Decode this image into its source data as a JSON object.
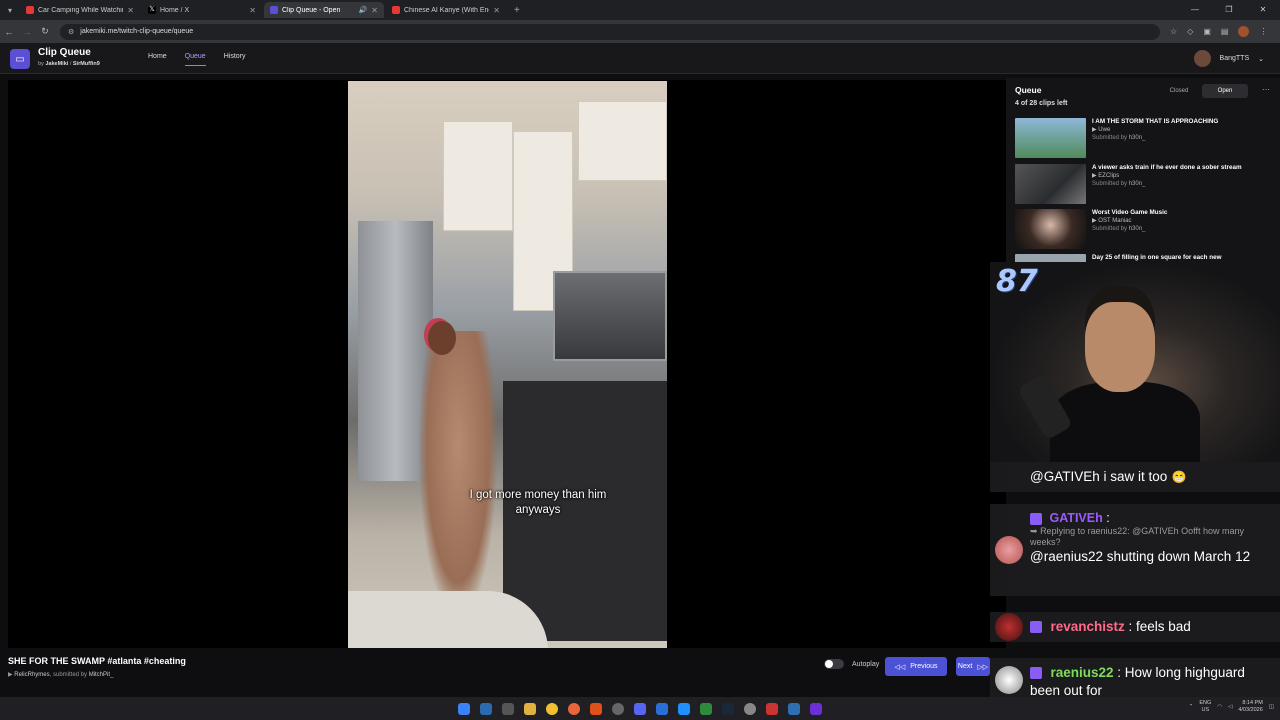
{
  "browser": {
    "tabs": [
      {
        "label": "Car Camping While Watching a",
        "active": false,
        "color": "#e53935"
      },
      {
        "label": "Home / X",
        "active": false,
        "color": "#000000"
      },
      {
        "label": "Clip Queue - Open",
        "active": true,
        "color": "#5b4fd6"
      },
      {
        "label": "Chinese AI Kanye (With English",
        "active": false,
        "color": "#e53935"
      }
    ],
    "url": "jakemiki.me/twitch-clip-queue/queue"
  },
  "app": {
    "title": "Clip Queue",
    "by_prefix": "by",
    "author1": "JakeMiki",
    "separator": "/",
    "author2": "SirMuffin9",
    "nav": [
      "Home",
      "Queue",
      "History"
    ],
    "active_nav": "Queue",
    "username": "BangTTS"
  },
  "video": {
    "caption_line1": "I got more money than him",
    "caption_line2": "anyways"
  },
  "queue": {
    "title": "Queue",
    "remaining": "4 of 28 clips left",
    "toggle_closed": "Closed",
    "toggle_open": "Open",
    "submitted_prefix": "Submitted by",
    "clips": [
      {
        "title": "I AM THE STORM THAT IS APPROACHING",
        "channel": "Uwe",
        "submitter": "h30n_",
        "thumb": "#4f8a5a"
      },
      {
        "title": "A viewer asks train if he ever done a sober stream",
        "channel": "EZClips",
        "submitter": "h30n_",
        "thumb": "#3b3f44"
      },
      {
        "title": "Worst Video Game Music",
        "channel": "OST Maniac",
        "submitter": "h30n_",
        "thumb": "#2d2a28"
      },
      {
        "title": "Day 25 of filling in one square for each new",
        "channel": "",
        "submitter": "",
        "thumb": "#9aa4ad"
      }
    ]
  },
  "stream": {
    "counter": "87"
  },
  "chat": [
    {
      "name": "",
      "body": "@GATIVEh i saw it too",
      "emote": "😁",
      "color": "#ffffff"
    },
    {
      "name": "GATIVEh",
      "reply": "Replying to raenius22: @GATIVEh Oofft how many weeks?",
      "body": "@raenius22 shutting down March 12",
      "color": "#9a5cff"
    },
    {
      "name": "revanchistz",
      "body": "feels bad",
      "color": "#ff6a8a"
    },
    {
      "name": "raenius22",
      "body": "How long highguard been out for",
      "color": "#7fdc5a"
    }
  ],
  "current_clip": {
    "title": "SHE FOR THE SWAMP #atlanta #cheating",
    "channel": "RelicRhymes",
    "submitted_by_label": "submitted by",
    "submitter": "MitchPit_"
  },
  "controls": {
    "autoplay_label": "Autoplay",
    "previous_label": "Previous",
    "next_label": "Next"
  },
  "taskbar": {
    "lang": "ENG",
    "region": "US",
    "time": "8:14 PM",
    "date": "4/03/2026"
  }
}
